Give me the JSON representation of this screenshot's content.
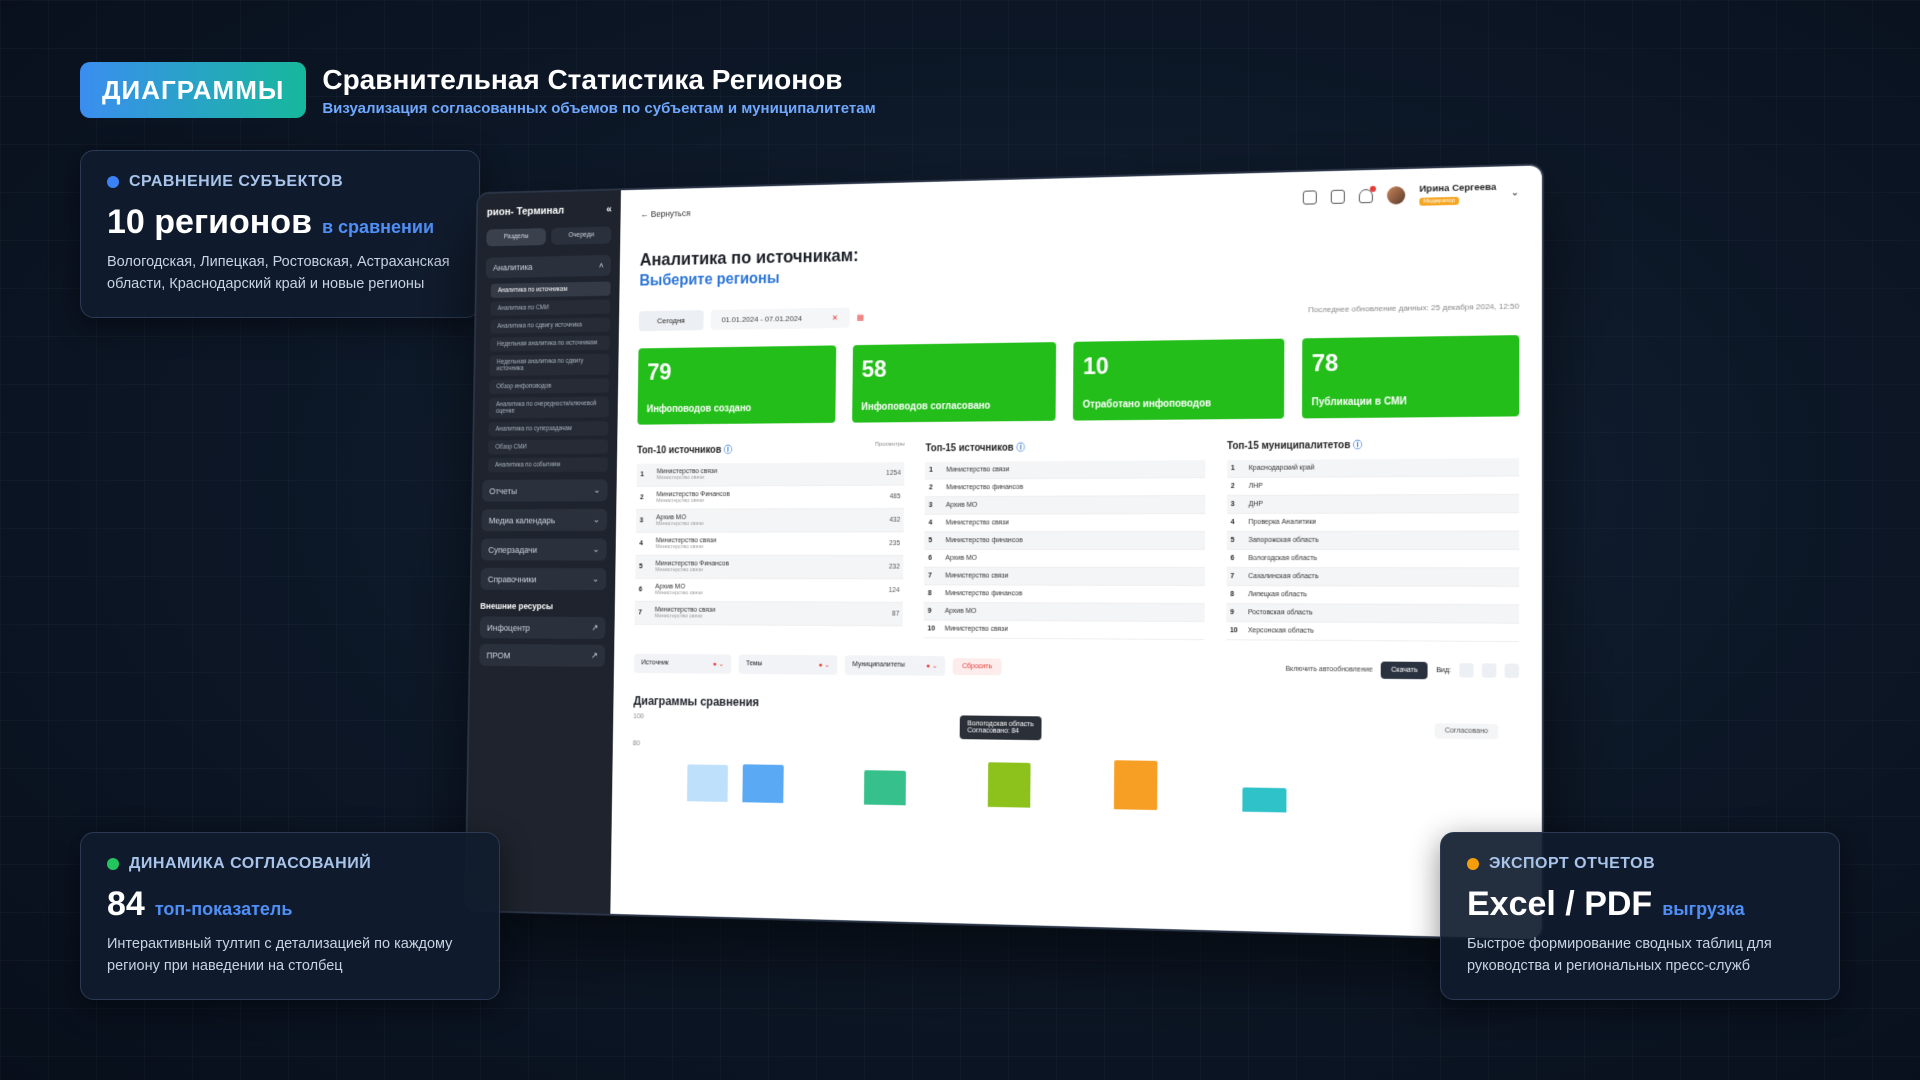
{
  "header": {
    "tag": "ДИАГРАММЫ",
    "title": "Сравнительная Статистика Регионов",
    "subtitle": "Визуализация согласованных объемов по субъектам и муниципалитетам"
  },
  "cards": {
    "compare": {
      "label": "СРАВНЕНИЕ СУБЪЕКТОВ",
      "big": "10 регионов",
      "accent": "в сравнении",
      "desc": "Вологодская, Липецкая, Ростовская, Астраханская области, Краснодарский край и новые регионы",
      "dot_color": "#3b82f6"
    },
    "dynamics": {
      "label": "ДИНАМИКА СОГЛАСОВАНИЙ",
      "big": "84",
      "accent": "топ-показатель",
      "desc": "Интерактивный тултип с детализацией по каждому региону при наведении на столбец",
      "dot_color": "#22c55e"
    },
    "export": {
      "label": "ЭКСПОРТ ОТЧЕТОВ",
      "big": "Excel / PDF",
      "accent": "выгрузка",
      "desc": "Быстрое формирование сводных таблиц для руководства и региональных пресс-служб",
      "dot_color": "#f59e0b"
    }
  },
  "app": {
    "sidebar": {
      "title": "рион- Терминал",
      "tabs": [
        "Разделы",
        "Очереди"
      ],
      "analytics_group": "Аналитика",
      "analytics_items": [
        "Аналитика по источникам",
        "Аналитика по СМИ",
        "Аналитика по сдвигу источника",
        "Недельная аналитика по источникам",
        "Недельная аналитика по сдвигу источника",
        "Обзор инфоповодов",
        "Аналитика по очередности/ключевой оценке",
        "Аналитика по суперзадачам",
        "Обзор СМИ",
        "Аналитика по событиям"
      ],
      "groups": [
        "Отчеты",
        "Медиа календарь",
        "Суперзадачи",
        "Справочники"
      ],
      "external_title": "Внешние ресурсы",
      "external": [
        "Инфоцентр",
        "ПРОМ"
      ]
    },
    "topbar": {
      "back": "← Вернуться",
      "user_name": "Ирина Сергеева",
      "user_badge": "Модератор"
    },
    "page_title": "Аналитика по источникам:",
    "page_sub": "Выберите регионы",
    "filters": {
      "today": "Сегодня",
      "range": "01.01.2024 - 07.01.2024",
      "updated": "Последнее обновление данных: 25 декабря 2024, 12:50"
    },
    "stats": [
      {
        "num": "79",
        "label": "Инфоповодов создано"
      },
      {
        "num": "58",
        "label": "Инфоповодов согласовано"
      },
      {
        "num": "10",
        "label": "Отработано инфоповодов"
      },
      {
        "num": "78",
        "label": "Публикации в СМИ"
      }
    ],
    "tables": {
      "top10": {
        "title": "Топ-10 источников",
        "col": "Просмотры",
        "rows": [
          {
            "n": "1",
            "name": "Министерство связи",
            "sub": "Министерство связи",
            "v": "1254"
          },
          {
            "n": "2",
            "name": "Министерство Финансов",
            "sub": "Министерство связи",
            "v": "485"
          },
          {
            "n": "3",
            "name": "Архив МО",
            "sub": "Министерство связи",
            "v": "432"
          },
          {
            "n": "4",
            "name": "Министерство связи",
            "sub": "Министерство связи",
            "v": "235"
          },
          {
            "n": "5",
            "name": "Министерство Финансов",
            "sub": "Министерство связи",
            "v": "232"
          },
          {
            "n": "6",
            "name": "Архив МО",
            "sub": "Министерство связи",
            "v": "124"
          },
          {
            "n": "7",
            "name": "Министерство связи",
            "sub": "Министерство связи",
            "v": "87"
          }
        ]
      },
      "top15": {
        "title": "Топ-15 источников",
        "rows": [
          {
            "n": "1",
            "name": "Министерство связи"
          },
          {
            "n": "2",
            "name": "Министерство финансов"
          },
          {
            "n": "3",
            "name": "Архив МО"
          },
          {
            "n": "4",
            "name": "Министерство связи"
          },
          {
            "n": "5",
            "name": "Министерство финансов"
          },
          {
            "n": "6",
            "name": "Архив МО"
          },
          {
            "n": "7",
            "name": "Министерство связи"
          },
          {
            "n": "8",
            "name": "Министерство финансов"
          },
          {
            "n": "9",
            "name": "Архив МО"
          },
          {
            "n": "10",
            "name": "Министерство связи"
          }
        ]
      },
      "top15mun": {
        "title": "Топ-15 муниципалитетов",
        "rows": [
          {
            "n": "1",
            "name": "Краснодарский край"
          },
          {
            "n": "2",
            "name": "ЛНР"
          },
          {
            "n": "3",
            "name": "ДНР"
          },
          {
            "n": "4",
            "name": "Проверка Аналитики"
          },
          {
            "n": "5",
            "name": "Запорожская область"
          },
          {
            "n": "6",
            "name": "Вологодская область"
          },
          {
            "n": "7",
            "name": "Сахалинская область"
          },
          {
            "n": "8",
            "name": "Липецкая область"
          },
          {
            "n": "9",
            "name": "Ростовская область"
          },
          {
            "n": "10",
            "name": "Херсонская область"
          }
        ]
      }
    },
    "controls": {
      "sources": "Источник",
      "topics": "Темы",
      "municipalities": "Муниципалитеты",
      "reset": "Сбросить",
      "auto": "Включить автообновление",
      "download": "Скачать",
      "view": "Вид:"
    },
    "charts": {
      "title": "Диаграммы сравнения",
      "legend_select": "Согласовано",
      "y_ticks": [
        "100",
        "80"
      ],
      "tooltip_title": "Вологодская область",
      "tooltip_value": "Согласовано: 84",
      "bar_colors": [
        "#bfe0fb",
        "#5aa9f5",
        "#35c08c",
        "#8cc21b",
        "#f79f24",
        "#30c2c9"
      ]
    }
  },
  "chart_data": {
    "type": "bar",
    "title": "Диаграммы сравнения",
    "ylim": [
      0,
      100
    ],
    "y_ticks": [
      80,
      100
    ],
    "values": [
      70,
      73,
      64,
      84,
      91,
      45
    ],
    "highlight": {
      "category": "Вологодская область",
      "value": 84
    }
  }
}
